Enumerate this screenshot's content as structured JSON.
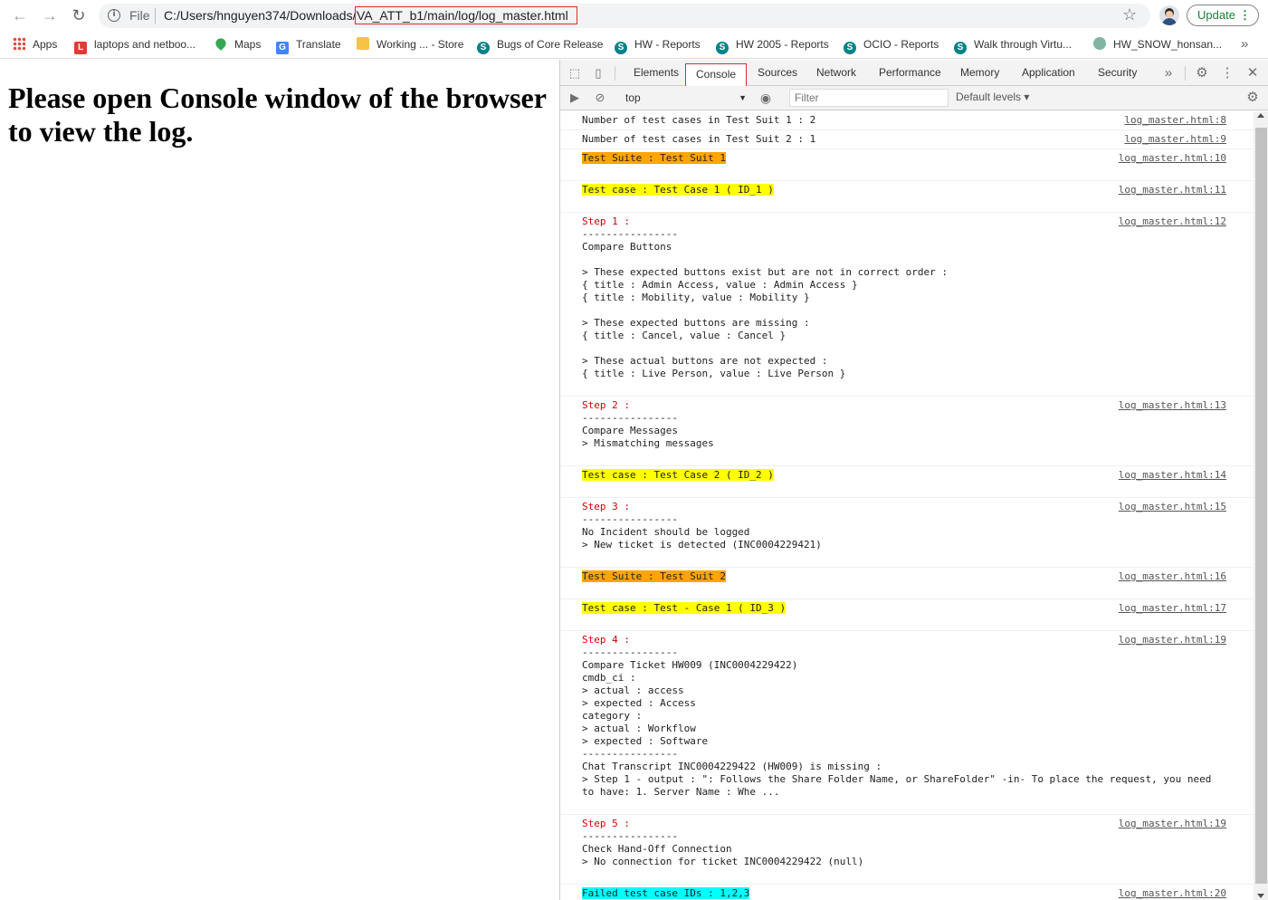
{
  "browser": {
    "nav": {
      "back": "←",
      "forward": "→",
      "reload": "↻"
    },
    "omnibox": {
      "file_label": "File",
      "url_base": "C:/Users/hnguyen374/Downloads/",
      "url_highlight": "VA_ATT_b1/main/log/log_master.html"
    },
    "update_label": "Update"
  },
  "bookmarks": [
    {
      "label": "Apps",
      "icon": "apps-grid-icon"
    },
    {
      "label": "laptops and netboo...",
      "icon": "letter-l-icon",
      "color": "#e53935"
    },
    {
      "label": "Maps",
      "icon": "maps-pin-icon",
      "color": "#34a853"
    },
    {
      "label": "Translate",
      "icon": "translate-icon",
      "color": "#4285f4"
    },
    {
      "label": "Working ... - Store",
      "icon": "folder-icon",
      "color": "#f6c344"
    },
    {
      "label": "Bugs of Core Release",
      "icon": "sharepoint-icon",
      "color": "#038387"
    },
    {
      "label": "HW - Reports",
      "icon": "sharepoint-icon",
      "color": "#038387"
    },
    {
      "label": "HW 2005 - Reports",
      "icon": "sharepoint-icon",
      "color": "#038387"
    },
    {
      "label": "OCIO - Reports",
      "icon": "sharepoint-icon",
      "color": "#038387"
    },
    {
      "label": "Walk through Virtu...",
      "icon": "sharepoint-icon",
      "color": "#038387"
    },
    {
      "label": "HW_SNOW_honsan...",
      "icon": "servicenow-icon",
      "color": "#81b5a1"
    }
  ],
  "page": {
    "heading": "Please open Console window of the browser to view the log."
  },
  "devtools": {
    "tabs": [
      "Elements",
      "Console",
      "Sources",
      "Network",
      "Performance",
      "Memory",
      "Application",
      "Security"
    ],
    "active_tab": "Console",
    "context": "top",
    "filter_placeholder": "Filter",
    "levels": "Default levels ▾",
    "messages": [
      {
        "text": "Number of test cases in Test Suit 1 : 2",
        "src": "log_master.html:8",
        "style": "plain"
      },
      {
        "text": "Number of test cases in Test Suit 2 : 1",
        "src": "log_master.html:9",
        "style": "plain"
      },
      {
        "text": "Test Suite : Test Suit 1",
        "src": "log_master.html:10",
        "style": "orange"
      },
      {
        "text": "Test case : Test Case 1 ( ID_1 )",
        "src": "log_master.html:11",
        "style": "yellow"
      },
      {
        "step": "Step 1 :",
        "text": "----------------\nCompare Buttons\n\n> These expected buttons exist but are not in correct order :\n{ title : Admin Access, value : Admin Access }\n{ title : Mobility, value : Mobility }\n\n> These expected buttons are missing :\n{ title : Cancel, value : Cancel }\n\n> These actual buttons are not expected :\n{ title : Live Person, value : Live Person }",
        "src": "log_master.html:12",
        "style": "step"
      },
      {
        "step": "Step 2 :",
        "text": "----------------\nCompare Messages\n> Mismatching messages",
        "src": "log_master.html:13",
        "style": "step"
      },
      {
        "text": "Test case : Test Case 2 ( ID_2 )",
        "src": "log_master.html:14",
        "style": "yellow"
      },
      {
        "step": "Step 3 :",
        "text": "----------------\nNo Incident should be logged\n> New ticket is detected (INC0004229421)",
        "src": "log_master.html:15",
        "style": "step"
      },
      {
        "text": "Test Suite : Test Suit 2",
        "src": "log_master.html:16",
        "style": "orange"
      },
      {
        "text": "Test case : Test - Case 1 ( ID_3 )",
        "src": "log_master.html:17",
        "style": "yellow"
      },
      {
        "step": "Step 4 :",
        "text": "----------------\nCompare Ticket HW009 (INC0004229422)\ncmdb_ci :\n> actual : access\n> expected : Access\ncategory :\n> actual : Workflow\n> expected : Software\n----------------\nChat Transcript INC0004229422 (HW009) is missing :\n> Step 1 - output : \": Follows the Share Folder Name, or ShareFolder\" -in- To place the request, you need to have: 1. Server Name : Whe ...",
        "src": "log_master.html:19",
        "style": "step"
      },
      {
        "step": "Step 5 :",
        "text": "----------------\nCheck Hand-Off Connection\n> No connection for ticket INC0004229422 (null)",
        "src": "log_master.html:19",
        "style": "step"
      },
      {
        "text": "Failed test case IDs : 1,2,3",
        "src": "log_master.html:20",
        "style": "cyan"
      }
    ]
  }
}
